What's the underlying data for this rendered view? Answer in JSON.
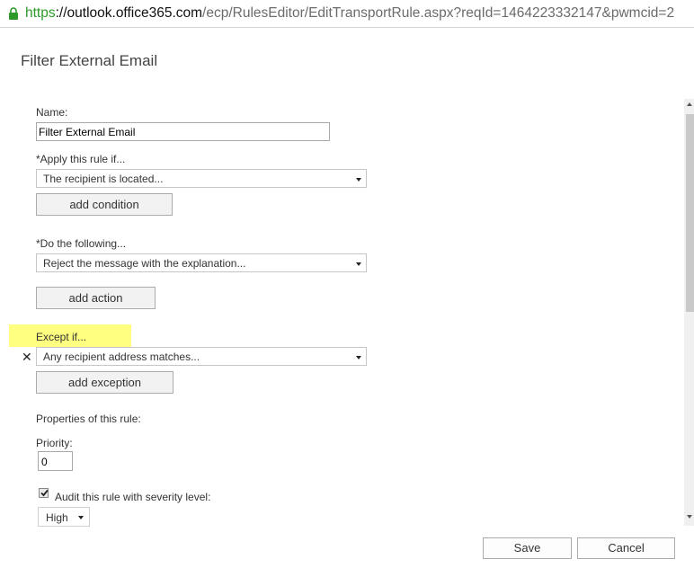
{
  "browser": {
    "url_scheme": "https",
    "url_host": "://outlook.office365.com",
    "url_path": "/ecp/RulesEditor/EditTransportRule.aspx?reqId=1464223332147&pwmcid=2"
  },
  "dialog": {
    "title": "Filter External Email"
  },
  "form": {
    "name_label": "Name:",
    "name_value": "Filter External Email",
    "apply_label": "*Apply this rule if...",
    "apply_value": "The recipient is located...",
    "add_condition": "add condition",
    "do_label": "*Do the following...",
    "do_value": "Reject the message with the explanation...",
    "add_action": "add action",
    "except_label": "Except if...",
    "except_value": "Any recipient address matches...",
    "add_exception": "add exception",
    "properties_label": "Properties of this rule:",
    "priority_label": "Priority:",
    "priority_value": "0",
    "audit_label": "Audit this rule with severity level:",
    "audit_checked": true,
    "severity_value": "High"
  },
  "footer": {
    "save": "Save",
    "cancel": "Cancel"
  },
  "colors": {
    "highlight": "#ffff80",
    "https_green": "#2b9a2b"
  }
}
